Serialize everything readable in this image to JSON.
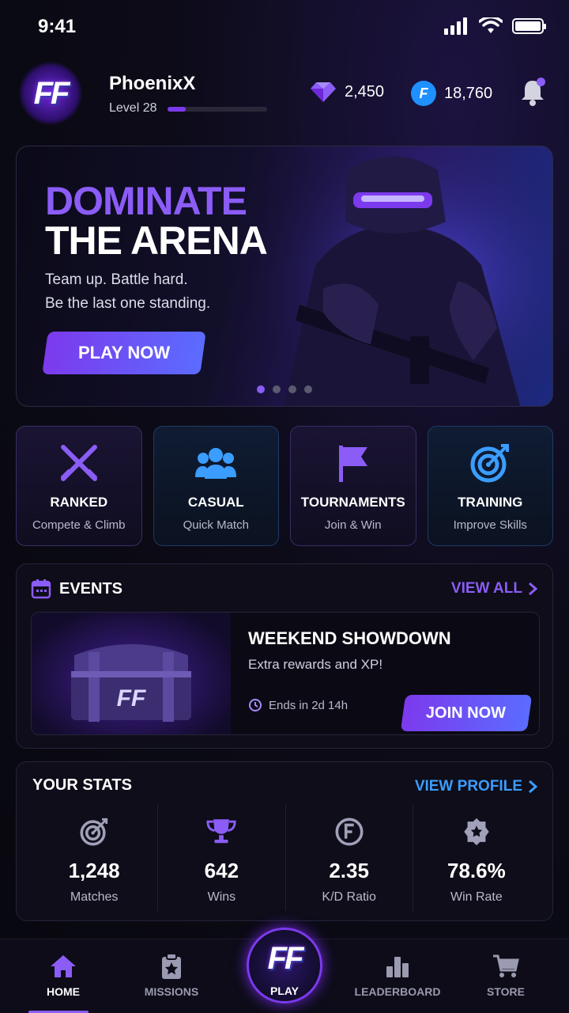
{
  "status_bar": {
    "time": "9:41"
  },
  "header": {
    "logo_text": "FF",
    "username": "PhoenixX",
    "level_label": "Level 28",
    "level_progress": 0.18,
    "gems": "2,450",
    "coins": "18,760",
    "coin_symbol": "F"
  },
  "hero": {
    "title_line1": "DOMINATE",
    "title_line2": "THE ARENA",
    "subtitle_line1": "Team up. Battle hard.",
    "subtitle_line2": "Be the last one standing.",
    "cta_label": "PLAY NOW",
    "carousel_count": 4,
    "carousel_active": 0
  },
  "modes": [
    {
      "title": "RANKED",
      "subtitle": "Compete & Climb",
      "icon": "crossed-swords-icon",
      "color": "#8b5cf6"
    },
    {
      "title": "CASUAL",
      "subtitle": "Quick Match",
      "icon": "group-icon",
      "color": "#3b9dff"
    },
    {
      "title": "TOURNAMENTS",
      "subtitle": "Join & Win",
      "icon": "flag-icon",
      "color": "#8b5cf6"
    },
    {
      "title": "TRAINING",
      "subtitle": "Improve Skills",
      "icon": "target-icon",
      "color": "#3b9dff"
    }
  ],
  "events": {
    "title": "EVENTS",
    "view_all": "VIEW ALL",
    "card": {
      "title": "WEEKEND SHOWDOWN",
      "subtitle": "Extra rewards and XP!",
      "timer": "Ends in 2d 14h",
      "cta_label": "JOIN NOW",
      "chest_logo": "FF"
    }
  },
  "stats": {
    "title": "YOUR STATS",
    "view_profile": "VIEW PROFILE",
    "items": [
      {
        "value": "1,248",
        "label": "Matches",
        "icon": "target-icon"
      },
      {
        "value": "642",
        "label": "Wins",
        "icon": "trophy-icon"
      },
      {
        "value": "2.35",
        "label": "K/D Ratio",
        "icon": "f-coin-icon"
      },
      {
        "value": "78.6%",
        "label": "Win Rate",
        "icon": "star-badge-icon"
      }
    ]
  },
  "nav": {
    "home": "HOME",
    "missions": "MISSIONS",
    "play": "PLAY",
    "leaderboard": "LEADERBOARD",
    "store": "STORE",
    "play_logo": "FF"
  },
  "colors": {
    "accent_purple": "#8b5cf6",
    "accent_blue": "#3b9dff",
    "background": "#08080f"
  }
}
